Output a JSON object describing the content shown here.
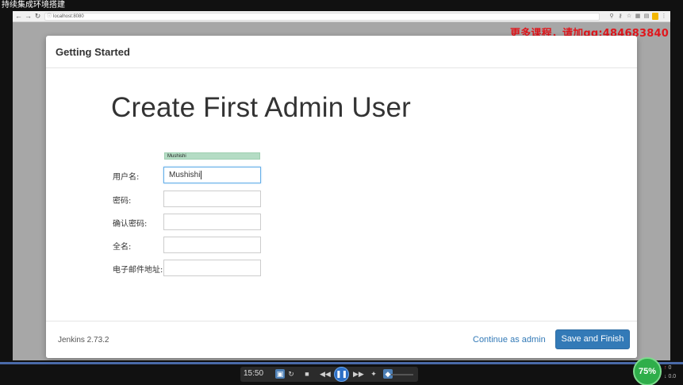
{
  "player": {
    "title": "持续集成环境搭建"
  },
  "browser": {
    "url": "localhost:8080"
  },
  "watermark": "更多课程，请加qq:484683840",
  "modal": {
    "header": "Getting Started",
    "title": "Create First Admin User",
    "fields": [
      {
        "label": "用户名:",
        "value": "Mushishi",
        "placeholder": ""
      },
      {
        "label": "密码:",
        "value": "",
        "placeholder": ""
      },
      {
        "label": "确认密码:",
        "value": "",
        "placeholder": ""
      },
      {
        "label": "全名:",
        "value": "",
        "placeholder": ""
      },
      {
        "label": "电子邮件地址:",
        "value": "",
        "placeholder": ""
      }
    ],
    "autocomplete_suggestion": "Mushishi",
    "footer": {
      "version": "Jenkins 2.73.2",
      "continue_label": "Continue as admin",
      "save_label": "Save and Finish"
    }
  },
  "video": {
    "time": "15:50",
    "net_percent": "75%",
    "net_up": "0",
    "net_down": "0.0"
  },
  "colors": {
    "primary": "#337ab7",
    "watermark": "#e0161c",
    "autocomplete_bg": "#b4dcc4"
  }
}
